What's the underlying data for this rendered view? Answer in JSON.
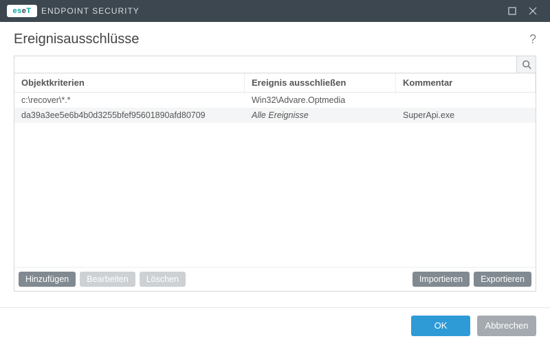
{
  "titlebar": {
    "brand_logo": "eseT",
    "brand_text": "ENDPOINT SECURITY"
  },
  "header": {
    "title": "Ereignisausschlüsse"
  },
  "search": {
    "value": ""
  },
  "table": {
    "columns": [
      "Objektkriterien",
      "Ereignis ausschließen",
      "Kommentar"
    ],
    "rows": [
      {
        "criteria": "c:\\recover\\*.*",
        "event": "Win32\\Advare.Optmedia",
        "event_italic": false,
        "comment": ""
      },
      {
        "criteria": "da39a3ee5e6b4b0d3255bfef95601890afd80709",
        "event": "Alle Ereignisse",
        "event_italic": true,
        "comment": "SuperApi.exe"
      }
    ]
  },
  "toolbar": {
    "add": "Hinzufügen",
    "edit": "Bearbeiten",
    "delete": "Löschen",
    "import": "Importieren",
    "export": "Exportieren"
  },
  "footer": {
    "ok": "OK",
    "cancel": "Abbrechen"
  }
}
